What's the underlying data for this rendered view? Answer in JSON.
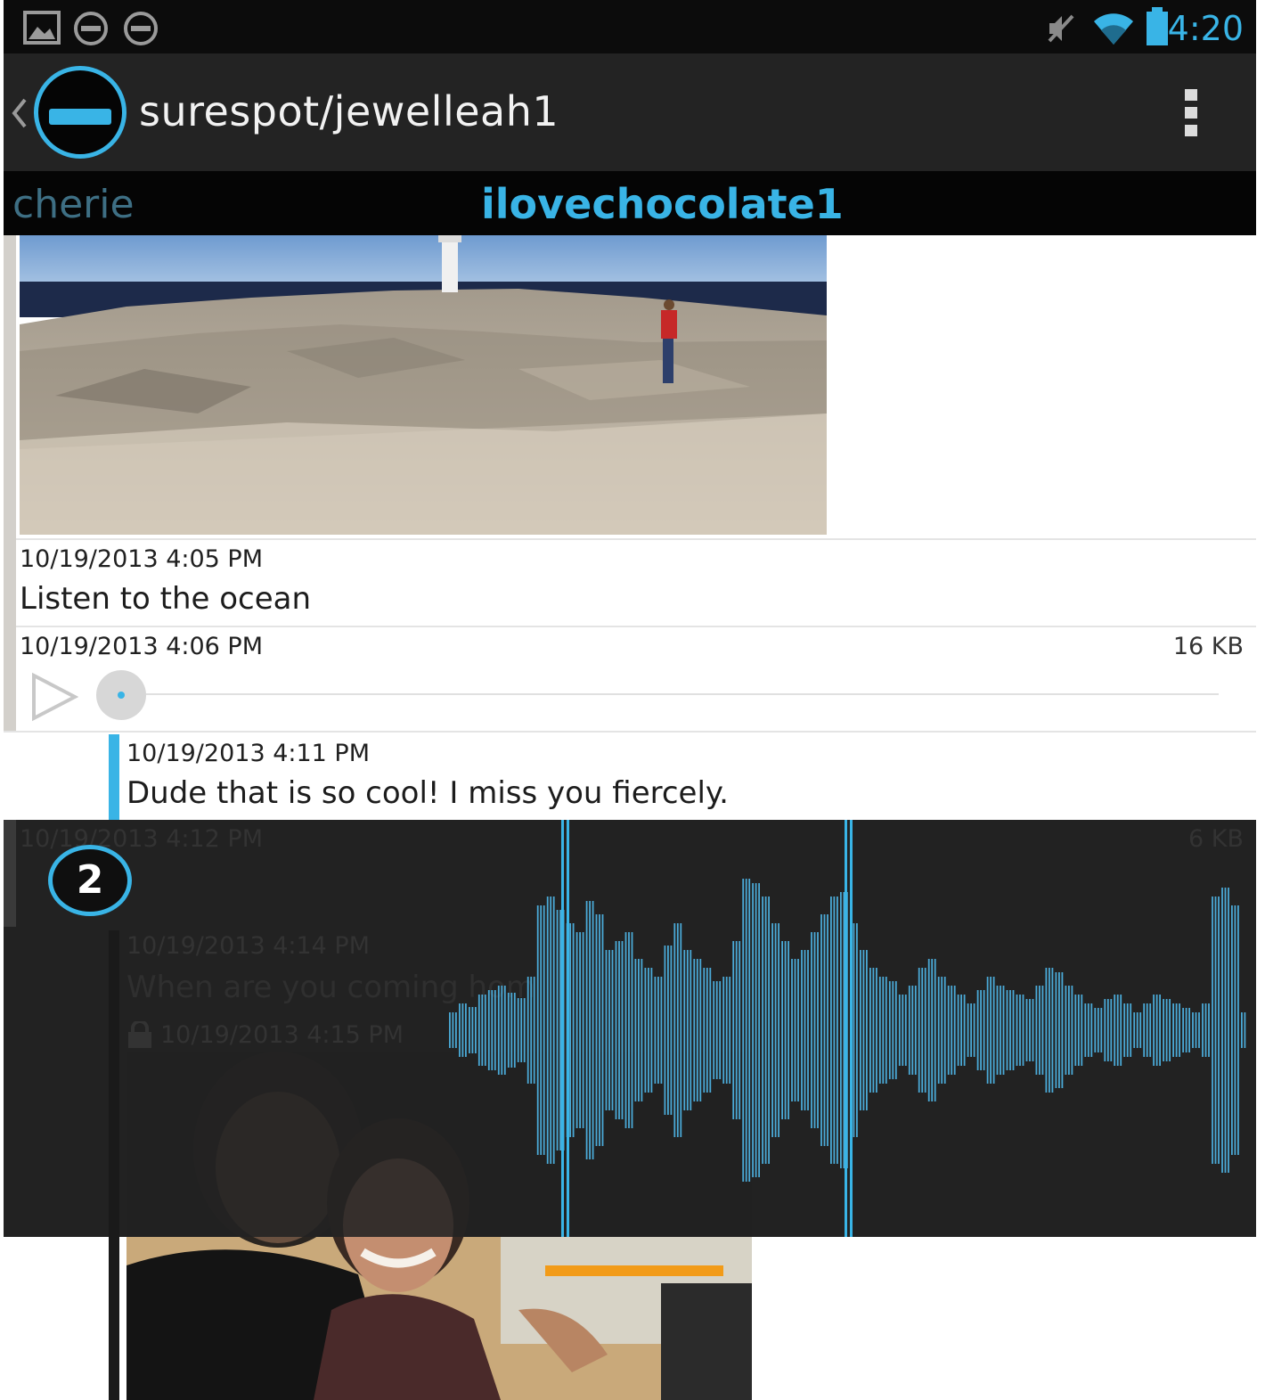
{
  "status_bar": {
    "time": "4:20",
    "icons": [
      "image-notification-icon",
      "blocked-notification-icon",
      "blocked-notification-icon-2",
      "muted-icon",
      "wifi-icon",
      "battery-icon"
    ]
  },
  "action_bar": {
    "title": "surespot/jewelleah1",
    "icons": [
      "back-chevron-icon",
      "surespot-logo-icon",
      "overflow-menu-icon"
    ]
  },
  "tabs": [
    {
      "label": "cherie",
      "active": false
    },
    {
      "label": "ilovechocolate1",
      "active": true
    }
  ],
  "messages": [
    {
      "type": "image",
      "time": "10/19/2013 4:05 PM",
      "text": "Listen to the ocean"
    },
    {
      "type": "voice",
      "time": "10/19/2013 4:06 PM",
      "size": "16 KB"
    },
    {
      "type": "text",
      "time": "10/19/2013 4:11 PM",
      "text": "Dude that is so cool! I miss you fiercely."
    },
    {
      "type": "voice",
      "time": "10/19/2013 4:12 PM",
      "size": "6 KB"
    },
    {
      "type": "text",
      "time": "10/19/2013 4:14 PM",
      "text": "When are you coming hom"
    },
    {
      "type": "image",
      "time": "10/19/2013 4:15 PM"
    }
  ],
  "overlay": {
    "badge_number": "2"
  },
  "colors": {
    "accent": "#39b4e6",
    "status_bar_bg": "#0c0c0c",
    "action_bar_bg": "#232323",
    "tab_bg": "#050505",
    "overlay_bg": "#222222"
  }
}
